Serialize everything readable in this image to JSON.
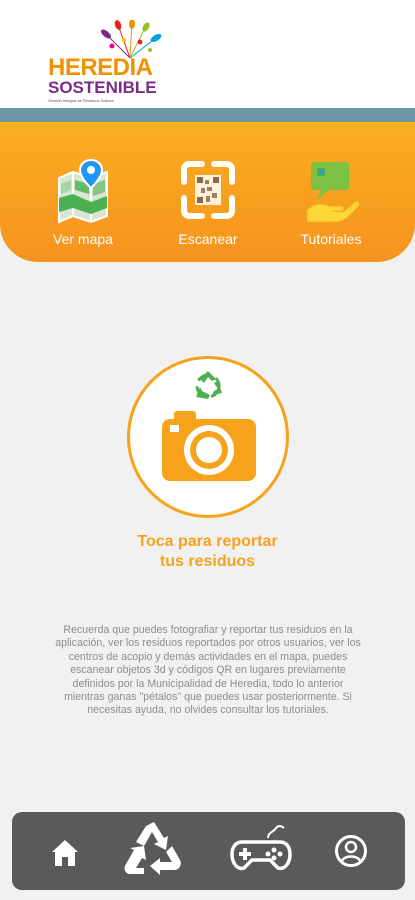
{
  "app": {
    "logo": {
      "line1": "HEREDIA",
      "line2": "SOSTENIBLE",
      "line3": "Gestión Integral de Residuos Sólidos"
    }
  },
  "menu": {
    "items": [
      {
        "label": "Ver mapa",
        "icon": "map-pin-icon"
      },
      {
        "label": "Escanear",
        "icon": "qr-scan-icon"
      },
      {
        "label": "Tutoriales",
        "icon": "tutorial-hand-icon"
      }
    ]
  },
  "report": {
    "label_line1": "Toca para reportar",
    "label_line2": "tus residuos",
    "icon": "camera-recycle-icon"
  },
  "info": {
    "text": "Recuerda que puedes fotografiar y reportar tus residuos en la aplicación, ver los residuos reportados por otros usuarios, ver los centros de acopio y demás actividades en el mapa, puedes escanear objetos 3d y códigos QR en lugares previamente definidos por la Municipalidad de Heredia, todo lo anterior mientras ganas \"pétalos\" que puedes usar posteriormente. Si necesitas ayuda, no olvides consultar los tutoriales."
  },
  "bottom_nav": {
    "items": [
      {
        "icon": "home-icon"
      },
      {
        "icon": "recycle-icon"
      },
      {
        "icon": "gamepad-icon"
      },
      {
        "icon": "user-profile-icon"
      }
    ]
  },
  "colors": {
    "orange": "#f6931f",
    "orange_light": "#fbad1f",
    "band": "#6a96a7",
    "nav": "#5a5a5a",
    "green": "#4caf50"
  }
}
